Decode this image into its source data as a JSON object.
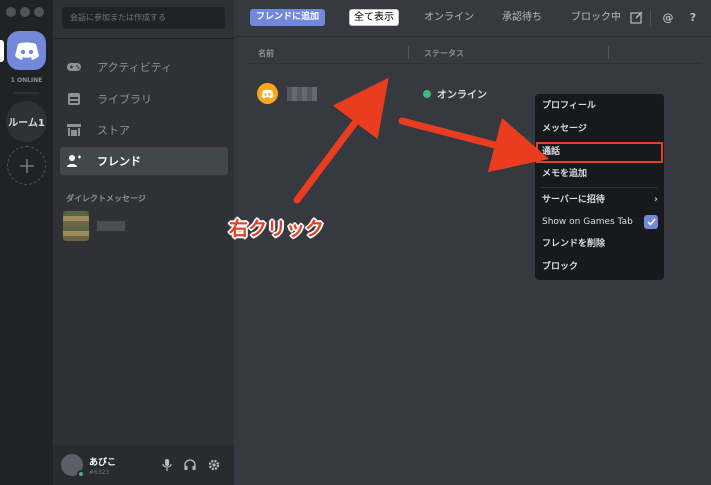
{
  "server_rail": {
    "online_count": "1 ONLINE",
    "server_name": "ルーム1",
    "accent_color": "#7289da"
  },
  "sidebar": {
    "search_placeholder": "会話に参加または作成する",
    "items": [
      {
        "label": "アクティビティ",
        "icon": "gamepad-icon"
      },
      {
        "label": "ライブラリ",
        "icon": "library-icon"
      },
      {
        "label": "ストア",
        "icon": "store-icon"
      },
      {
        "label": "フレンド",
        "icon": "friends-icon",
        "active": true
      }
    ],
    "dm_header": "ダイレクトメッセージ"
  },
  "user_panel": {
    "username": "あびこ",
    "tag": "#6323",
    "status_color": "#43b581"
  },
  "topbar": {
    "add_friend_label": "フレンドに追加",
    "tabs": [
      "全て表示",
      "オンライン",
      "承認待ち",
      "ブロック中"
    ],
    "selected_tab": "全て表示"
  },
  "friends_table": {
    "columns": [
      "名前",
      "ステータス"
    ],
    "rows": [
      {
        "status": "オンライン",
        "status_color": "#43b581"
      }
    ]
  },
  "context_menu": {
    "items": [
      "プロフィール",
      "メッセージ",
      "通話",
      "メモを追加",
      "サーバーに招待",
      "Show on Games Tab",
      "フレンドを削除",
      "ブロック"
    ],
    "highlighted": "通話",
    "highlight_color": "#ea3d1f"
  },
  "annotation": {
    "label": "右クリック",
    "color": "#ea3d1f"
  }
}
